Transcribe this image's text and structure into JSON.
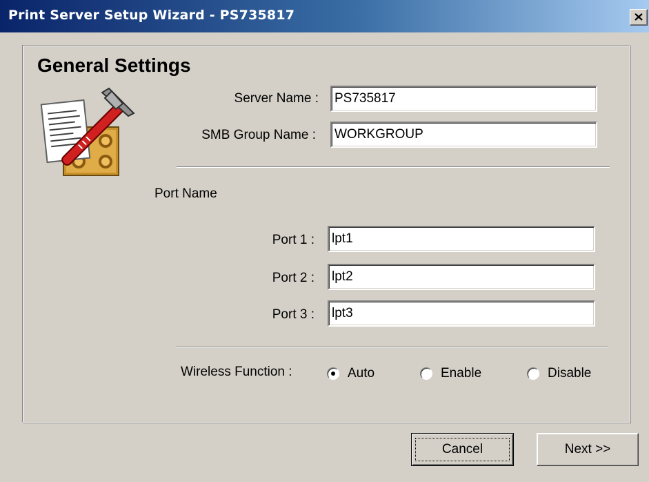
{
  "window": {
    "title": "Print Server Setup Wizard - PS735817",
    "close_icon": "close-icon"
  },
  "page": {
    "heading": "General Settings",
    "icon": "settings-wrench-hammer-icon"
  },
  "server": {
    "name_label": "Server Name :",
    "name_value": "PS735817",
    "group_label": "SMB Group Name :",
    "group_value": "WORKGROUP"
  },
  "ports": {
    "section_label": "Port Name",
    "items": [
      {
        "label": "Port 1 :",
        "value": "lpt1"
      },
      {
        "label": "Port 2 :",
        "value": "lpt2"
      },
      {
        "label": "Port 3 :",
        "value": "lpt3"
      }
    ]
  },
  "wireless": {
    "label": "Wireless Function :",
    "options": [
      {
        "label": "Auto",
        "selected": true
      },
      {
        "label": "Enable",
        "selected": false
      },
      {
        "label": "Disable",
        "selected": false
      }
    ]
  },
  "buttons": {
    "cancel": "Cancel",
    "next": "Next >>"
  }
}
